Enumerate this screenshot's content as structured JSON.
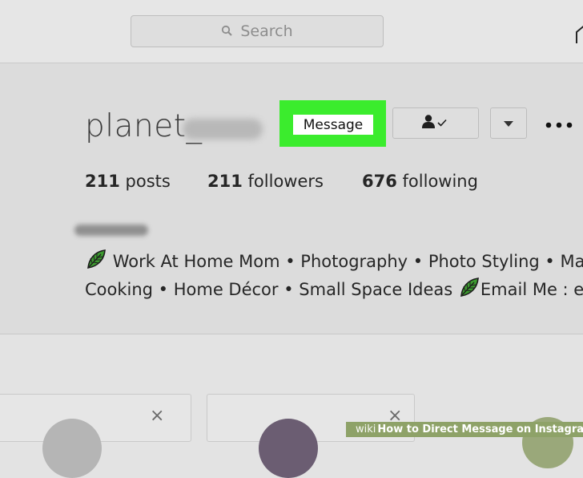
{
  "header": {
    "search_placeholder": "Search"
  },
  "profile": {
    "username": "planet_",
    "message_button": "Message",
    "stats": {
      "posts_count": "211",
      "posts_label": "posts",
      "followers_count": "211",
      "followers_label": "followers",
      "following_count": "676",
      "following_label": "following"
    },
    "bio_line1": "Work At Home Mom • Photography • Photo Styling • Ma",
    "bio_line2_a": "Cooking • Home Décor • Small Space Ideas ",
    "bio_line2_b": "Email Me : ec"
  },
  "suggestion_cards": [
    {
      "close_label": "×"
    },
    {
      "close_label": "×"
    }
  ],
  "watermark": {
    "brand": "wiki",
    "how": "How",
    "text": " to Direct Message on Instagram"
  },
  "colors": {
    "highlight": "#3bec2d",
    "leaf": "#2e8b2e"
  }
}
